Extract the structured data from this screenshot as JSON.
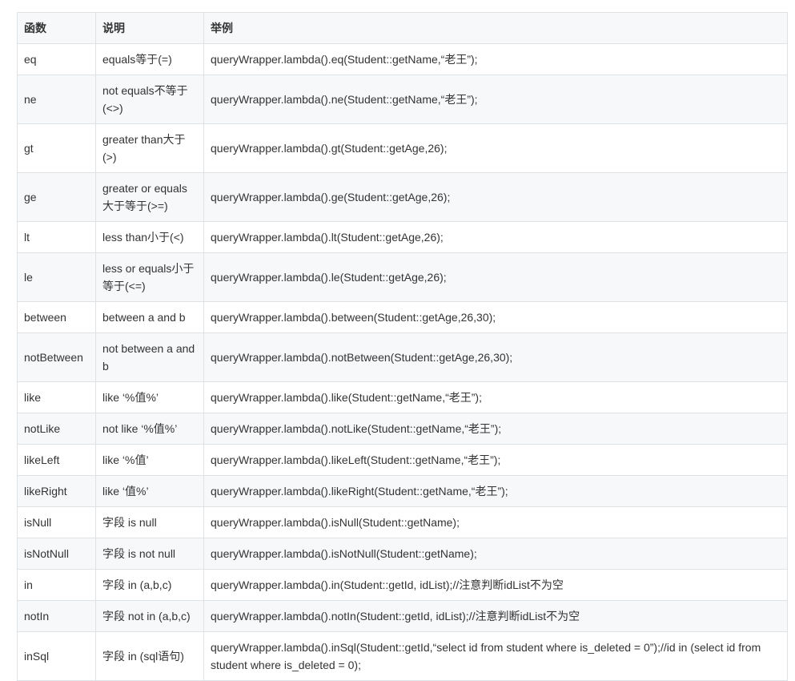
{
  "table": {
    "headers": [
      "函数",
      "说明",
      "举例"
    ],
    "rows": [
      {
        "fn": "eq",
        "desc": "equals等于(=)",
        "example": "queryWrapper.lambda().eq(Student::getName,“老王”);"
      },
      {
        "fn": "ne",
        "desc": "not equals不等于(<>)",
        "example": "queryWrapper.lambda().ne(Student::getName,“老王”);"
      },
      {
        "fn": "gt",
        "desc": "greater than大于(>)",
        "example": "queryWrapper.lambda().gt(Student::getAge,26);"
      },
      {
        "fn": "ge",
        "desc": "greater or equals 大于等于(>=)",
        "example": "queryWrapper.lambda().ge(Student::getAge,26);"
      },
      {
        "fn": "lt",
        "desc": "less than小于(<)",
        "example": "queryWrapper.lambda().lt(Student::getAge,26);"
      },
      {
        "fn": "le",
        "desc": "less or equals小于等于(<=)",
        "example": "queryWrapper.lambda().le(Student::getAge,26);"
      },
      {
        "fn": "between",
        "desc": "between a and b",
        "example": "queryWrapper.lambda().between(Student::getAge,26,30);"
      },
      {
        "fn": "notBetween",
        "desc": "not between a and b",
        "example": "queryWrapper.lambda().notBetween(Student::getAge,26,30);"
      },
      {
        "fn": "like",
        "desc": "like ‘%值%’",
        "example": "queryWrapper.lambda().like(Student::getName,“老王”);"
      },
      {
        "fn": "notLike",
        "desc": "not like ‘%值%’",
        "example": "queryWrapper.lambda().notLike(Student::getName,“老王”);"
      },
      {
        "fn": "likeLeft",
        "desc": "like ‘%值’",
        "example": "queryWrapper.lambda().likeLeft(Student::getName,“老王”);"
      },
      {
        "fn": "likeRight",
        "desc": "like ‘值%’",
        "example": "queryWrapper.lambda().likeRight(Student::getName,“老王”);"
      },
      {
        "fn": "isNull",
        "desc": "字段 is null",
        "example": "queryWrapper.lambda().isNull(Student::getName);"
      },
      {
        "fn": "isNotNull",
        "desc": "字段 is not null",
        "example": "queryWrapper.lambda().isNotNull(Student::getName);"
      },
      {
        "fn": "in",
        "desc": "字段 in (a,b,c)",
        "example": "queryWrapper.lambda().in(Student::getId, idList);//注意判断idList不为空"
      },
      {
        "fn": "notIn",
        "desc": "字段 not in (a,b,c)",
        "example": "queryWrapper.lambda().notIn(Student::getId, idList);//注意判断idList不为空"
      },
      {
        "fn": "inSql",
        "desc": "字段 in (sql语句)",
        "example": "queryWrapper.lambda().inSql(Student::getId,“select id from student where is_deleted = 0”);//id in (select id from student where is_deleted = 0);"
      }
    ]
  }
}
